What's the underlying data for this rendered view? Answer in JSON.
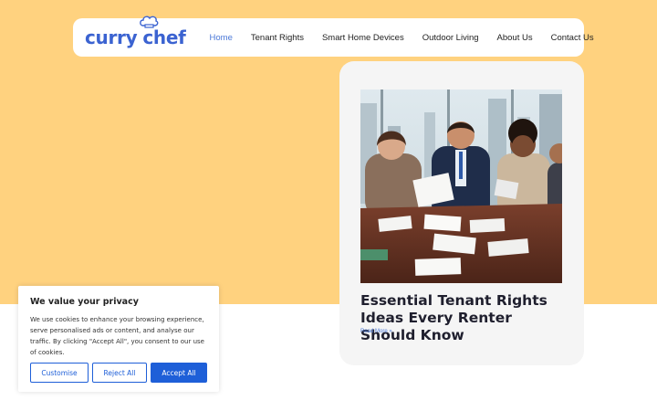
{
  "header": {
    "logo": {
      "part1": "curry",
      "part2": "chef",
      "icon": "chef-hat-icon"
    },
    "nav": [
      {
        "label": "Home",
        "active": true
      },
      {
        "label": "Tenant Rights",
        "active": false
      },
      {
        "label": "Smart Home Devices",
        "active": false
      },
      {
        "label": "Outdoor Living",
        "active": false
      },
      {
        "label": "About Us",
        "active": false
      },
      {
        "label": "Contact Us",
        "active": false
      }
    ]
  },
  "post": {
    "title": "Essential Tenant Rights Ideas Every Renter Should Know",
    "read_more": "Read More »"
  },
  "cookie": {
    "title": "We value your privacy",
    "text": "We use cookies to enhance your browsing experience, serve personalised ads or content, and analyse our traffic. By clicking \"Accept All\", you consent to our use of cookies.",
    "customise": "Customise",
    "reject": "Reject All",
    "accept": "Accept All"
  },
  "colors": {
    "hero_background": "#ffd27f",
    "brand_blue": "#3b63d1",
    "button_blue": "#1e5fd8",
    "card_background": "#f5f5f5"
  }
}
